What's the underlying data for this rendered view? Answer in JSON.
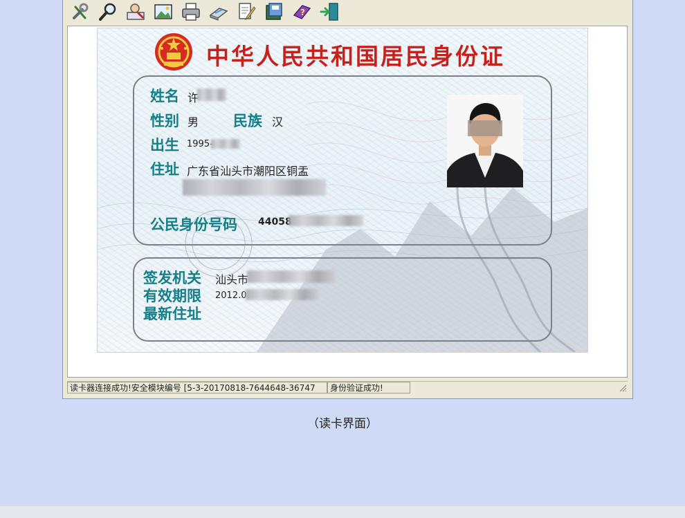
{
  "toolbar": {
    "icons": [
      "tools-icon",
      "magnifier-icon",
      "user-search-icon",
      "image-icon",
      "printer-icon",
      "scanner-icon",
      "document-edit-icon",
      "save-icon",
      "help-book-icon",
      "exit-icon"
    ]
  },
  "card": {
    "title": "中华人民共和国居民身份证",
    "name_label": "姓名",
    "name_value": "许",
    "sex_label": "性别",
    "sex_value": "男",
    "ethnic_label": "民族",
    "ethnic_value": "汉",
    "birth_label": "出生",
    "birth_value": "1995-",
    "address_label": "住址",
    "address_value": "广东省汕头市潮阳区铜盂",
    "id_label": "公民身份号码",
    "id_value": "44058",
    "authority_label": "签发机关",
    "authority_value": "汕头市",
    "validity_label": "有效期限",
    "validity_value": "2012.0",
    "latest_address_label": "最新住址",
    "colors": {
      "title": "#c8201b",
      "label": "#137f86"
    }
  },
  "status_bar": {
    "message": "读卡器连接成功!安全模块编号 [5-3-20170818-7644648-36747",
    "verify": "身份验证成功!"
  },
  "caption": "（读卡界面）"
}
